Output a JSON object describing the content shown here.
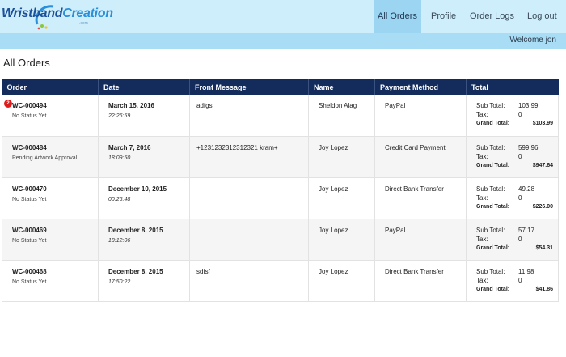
{
  "brand": {
    "part1": "Wristband",
    "part2": "Creation",
    "sub": ".com"
  },
  "nav": {
    "items": [
      {
        "label": "All Orders",
        "active": true
      },
      {
        "label": "Profile",
        "active": false
      },
      {
        "label": "Order Logs",
        "active": false
      },
      {
        "label": "Log out",
        "active": false
      }
    ]
  },
  "welcome": "Welcome jon",
  "page_title": "All Orders",
  "table": {
    "headers": [
      "Order",
      "Date",
      "Front Message",
      "Name",
      "Payment Method",
      "Total"
    ],
    "total_labels": {
      "sub": "Sub Total:",
      "tax": "Tax:",
      "grand": "Grand Total:"
    },
    "rows": [
      {
        "badge": "2",
        "order": "WC-000494",
        "status": "No Status Yet",
        "date": "March 15, 2016",
        "time": "22:26:59",
        "message": "adfgs",
        "name": "Sheldon Alag",
        "payment": "PayPal",
        "sub_total": "103.99",
        "tax": "0",
        "grand_total": "$103.99"
      },
      {
        "badge": "",
        "order": "WC-000484",
        "status": "Pending Artwork Approval",
        "date": "March 7, 2016",
        "time": "18:09:50",
        "message": "+1231232312312321 kram+",
        "name": "Joy Lopez",
        "payment": "Credit Card Payment",
        "sub_total": "599.96",
        "tax": "0",
        "grand_total": "$947.64"
      },
      {
        "badge": "",
        "order": "WC-000470",
        "status": "No Status Yet",
        "date": "December 10, 2015",
        "time": "00:26:48",
        "message": "",
        "name": "Joy Lopez",
        "payment": "Direct Bank Transfer",
        "sub_total": "49.28",
        "tax": "0",
        "grand_total": "$226.00"
      },
      {
        "badge": "",
        "order": "WC-000469",
        "status": "No Status Yet",
        "date": "December 8, 2015",
        "time": "18:12:06",
        "message": "",
        "name": "Joy Lopez",
        "payment": "PayPal",
        "sub_total": "57.17",
        "tax": "0",
        "grand_total": "$54.31"
      },
      {
        "badge": "",
        "order": "WC-000468",
        "status": "No Status Yet",
        "date": "December 8, 2015",
        "time": "17:50:22",
        "message": "sdfsf",
        "name": "Joy Lopez",
        "payment": "Direct Bank Transfer",
        "sub_total": "11.98",
        "tax": "0",
        "grand_total": "$41.86"
      }
    ]
  },
  "colors": {
    "topbar": "#cdeefa",
    "nav_active": "#9bd5f2",
    "welcome_bar": "#a9dcf5",
    "header": "#142c5c",
    "badge": "#e01b1b"
  }
}
